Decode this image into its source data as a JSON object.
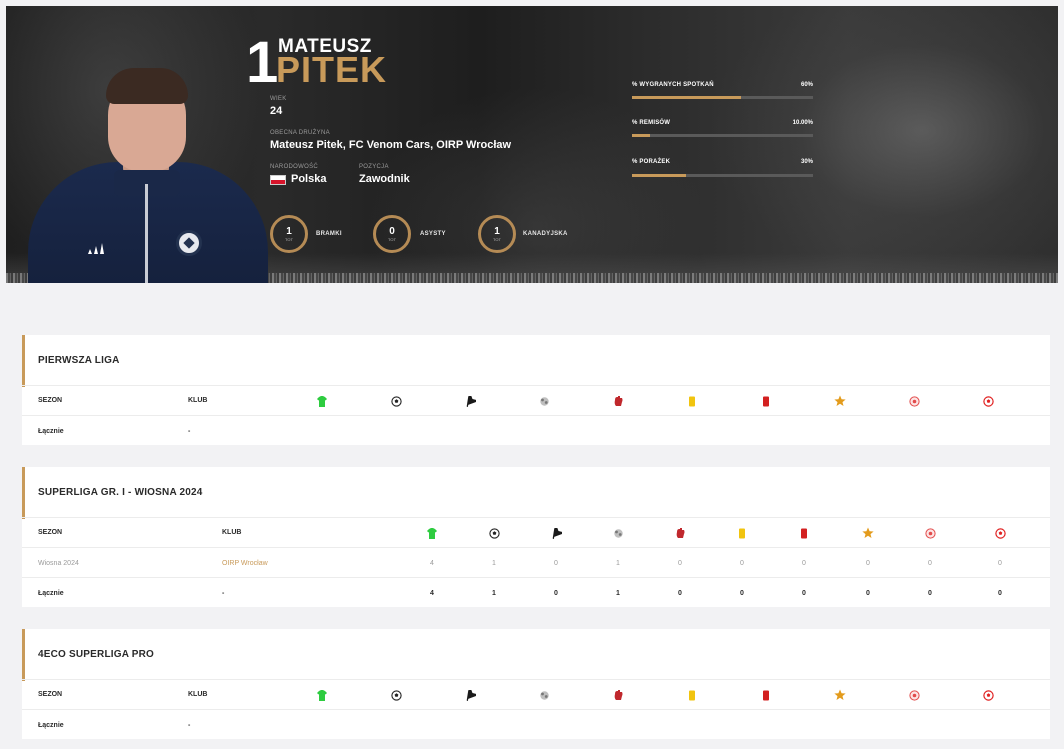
{
  "player": {
    "number": "1",
    "first_name": "MATEUSZ",
    "last_name": "PITEK",
    "age_label": "WIEK",
    "age": "24",
    "team_label": "OBECNA DRUŻYNA",
    "team": "Mateusz Pitek, FC Venom Cars, OIRP Wrocław",
    "nationality_label": "NARODOWOŚĆ",
    "nationality": "Polska",
    "position_label": "POZYCJA",
    "position": "Zawodnik"
  },
  "stats": [
    {
      "value": "1",
      "sub": "TOT",
      "name": "BRAMKI"
    },
    {
      "value": "0",
      "sub": "TOT",
      "name": "ASYSTY"
    },
    {
      "value": "1",
      "sub": "TOT",
      "name": "KANADYJSKA"
    }
  ],
  "bars": [
    {
      "label": "% WYGRANYCH SPOTKAŃ",
      "value": "60%",
      "fraction": 0.6
    },
    {
      "label": "% REMISÓW",
      "value": "10.00%",
      "fraction": 0.1
    },
    {
      "label": "% PORAŻEK",
      "value": "30%",
      "fraction": 0.3
    }
  ],
  "table_headers": {
    "season": "SEZON",
    "club": "KLUB"
  },
  "icons": [
    "shirt-icon",
    "ball-icon",
    "boot-icon",
    "wall-icon",
    "glove-icon",
    "yellow-card-icon",
    "red-card-icon",
    "star-icon",
    "own-goal-icon",
    "penalty-icon"
  ],
  "colors": {
    "accent": "#c89a5a",
    "yellow": "#f1c40f",
    "red": "#d32020",
    "green": "#2ecc40"
  },
  "sections": [
    {
      "title": "PIERWSZA LIGA",
      "rows": [],
      "total": {
        "season": "Łącznie",
        "club": "-",
        "values": []
      }
    },
    {
      "title": "SUPERLIGA GR. I - WIOSNA 2024",
      "rows": [
        {
          "season": "Wiosna 2024",
          "club": "OIRP Wrocław",
          "values": [
            "4",
            "1",
            "0",
            "1",
            "0",
            "0",
            "0",
            "0",
            "0",
            "0"
          ]
        }
      ],
      "total": {
        "season": "Łącznie",
        "club": "-",
        "values": [
          "4",
          "1",
          "0",
          "1",
          "0",
          "0",
          "0",
          "0",
          "0",
          "0"
        ]
      }
    },
    {
      "title": "4ECO SUPERLIGA PRO",
      "rows": [],
      "total": {
        "season": "Łącznie",
        "club": "-",
        "values": []
      }
    }
  ]
}
